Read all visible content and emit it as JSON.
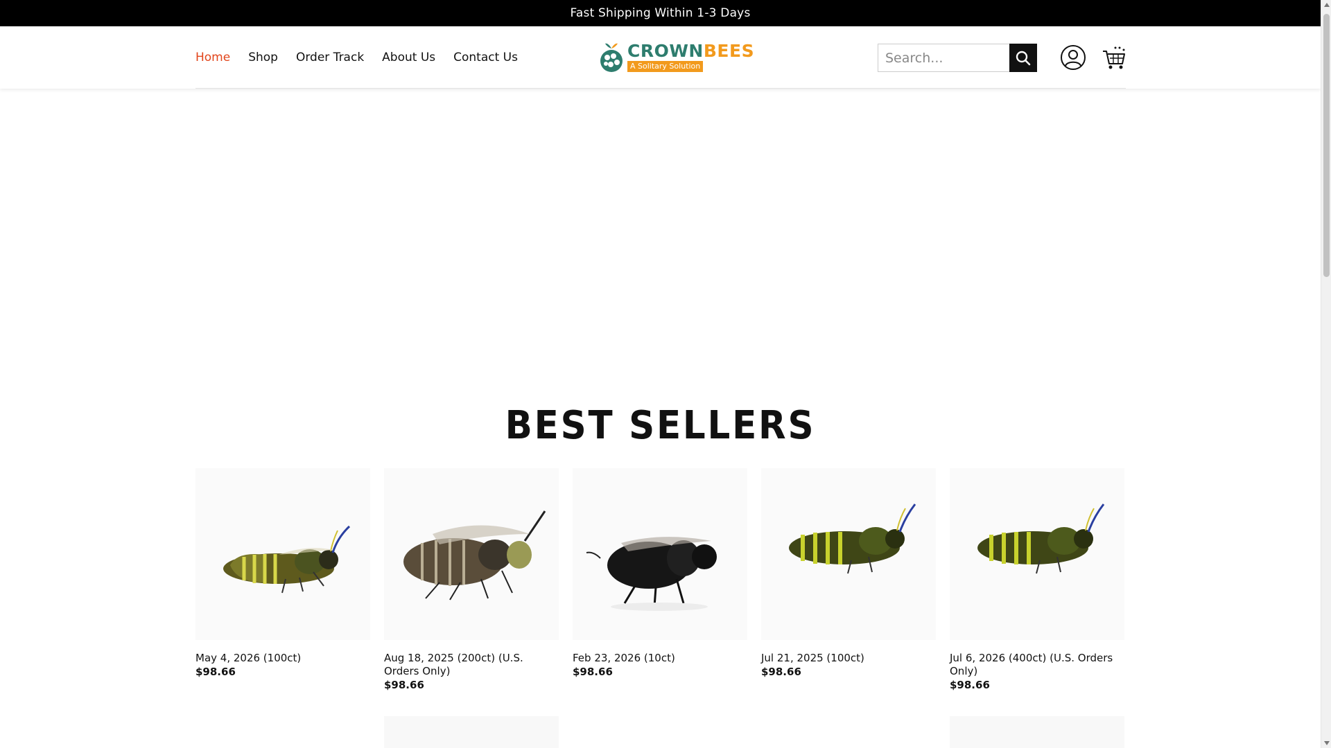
{
  "topbar": {
    "text": "Fast Shipping Within 1-3 Days"
  },
  "nav": [
    {
      "label": "Home",
      "active": true
    },
    {
      "label": "Shop"
    },
    {
      "label": "Order Track"
    },
    {
      "label": "About Us"
    },
    {
      "label": "Contact Us"
    }
  ],
  "logo": {
    "name_part1": "CROWN",
    "name_part2": "BEES",
    "tagline": "A Solitary Solution"
  },
  "search": {
    "placeholder": "Search..."
  },
  "icons": {
    "search": "search-icon",
    "account": "user-icon",
    "cart": "cart-icon"
  },
  "colors": {
    "accent": "#e2451b",
    "brand_green": "#2e7d6e",
    "brand_orange": "#f29a1d"
  },
  "section": {
    "title": "BEST SELLERS"
  },
  "products": [
    {
      "name": "May 4, 2026 (100ct)",
      "price": "$98.66",
      "bee": "yellow"
    },
    {
      "name": "Aug 18, 2025 (200ct) (U.S. Orders Only)",
      "price": "$98.66",
      "bee": "brown"
    },
    {
      "name": "Feb 23, 2026 (10ct)",
      "price": "$98.66",
      "bee": "black"
    },
    {
      "name": "Jul 21, 2025 (100ct)",
      "price": "$98.66",
      "bee": "yellow"
    },
    {
      "name": "Jul 6, 2026 (400ct) (U.S. Orders Only)",
      "price": "$98.66",
      "bee": "yellow"
    }
  ]
}
